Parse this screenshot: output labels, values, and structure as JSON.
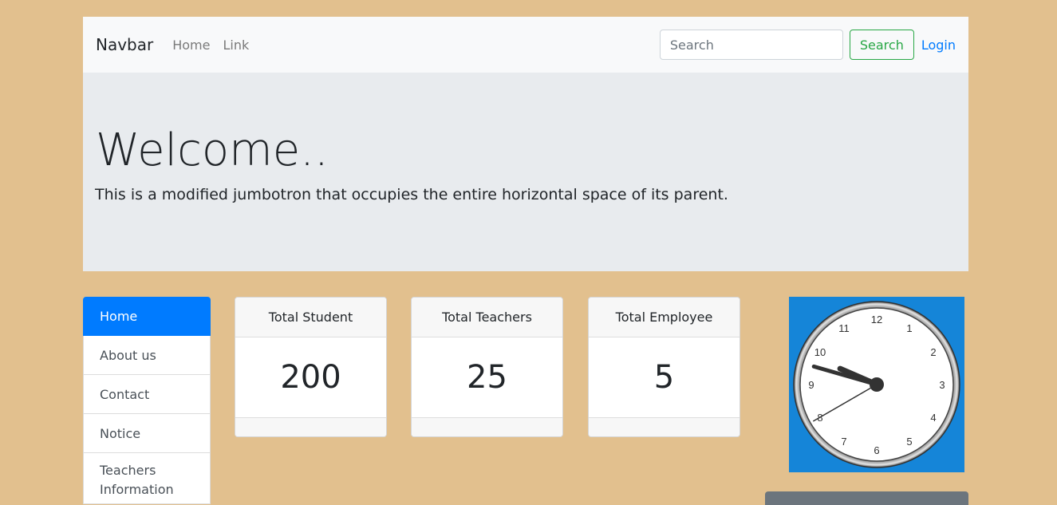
{
  "navbar": {
    "brand": "Navbar",
    "links": [
      "Home",
      "Link"
    ],
    "search_placeholder": "Search",
    "search_button": "Search",
    "login": "Login"
  },
  "jumbotron": {
    "title": "Welcome..",
    "text": "This is a modified jumbotron that occupies the entire horizontal space of its parent."
  },
  "sidebar": {
    "items": [
      {
        "label": "Home",
        "active": true
      },
      {
        "label": "About us"
      },
      {
        "label": "Contact"
      },
      {
        "label": "Notice"
      },
      {
        "label": "Teachers Information"
      }
    ]
  },
  "stats": [
    {
      "title": "Total Student",
      "value": "200"
    },
    {
      "title": "Total Teachers",
      "value": "25"
    },
    {
      "title": "Total Employee",
      "value": "5"
    }
  ],
  "clock": {
    "numbers": [
      "12",
      "1",
      "2",
      "3",
      "4",
      "5",
      "6",
      "7",
      "8",
      "9",
      "10",
      "11"
    ],
    "time": {
      "hour": 9,
      "minute": 47,
      "second": 40
    },
    "background": "#1585d8"
  },
  "colors": {
    "page_bg": "#e2c08e",
    "primary": "#007bff",
    "success": "#28a745"
  }
}
